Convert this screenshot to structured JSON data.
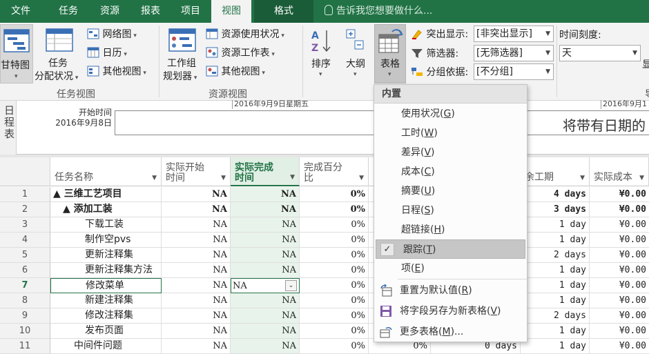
{
  "tabs": [
    {
      "label": "文件",
      "state": "normal"
    },
    {
      "label": "任务",
      "state": "normal"
    },
    {
      "label": "资源",
      "state": "normal"
    },
    {
      "label": "报表",
      "state": "normal"
    },
    {
      "label": "项目",
      "state": "normal"
    },
    {
      "label": "视图",
      "state": "active"
    },
    {
      "label": "格式",
      "state": "contextual"
    }
  ],
  "tell_me": "告诉我您想要做什么...",
  "ribbon": {
    "gantt_label": "甘特图",
    "task_usage_label_1": "任务",
    "task_usage_label_2": "分配状况",
    "network_label": "网络图",
    "calendar_label": "日历",
    "other_views_label": "其他视图",
    "task_views_group": "任务视图",
    "team_planner_label_1": "工作组",
    "team_planner_label_2": "规划器",
    "resource_usage_label": "资源使用状况",
    "resource_sheet_label": "资源工作表",
    "other_views_label_2": "其他视图",
    "resource_views_group": "资源视图",
    "sort_label": "排序",
    "outline_label": "大纲",
    "tables_label": "表格",
    "highlight_label": "突出显示:",
    "highlight_value": "[非突出显示]",
    "filter_label": "筛选器:",
    "filter_value": "[无筛选器]",
    "group_label": "分组依据:",
    "group_value": "[不分组]",
    "timescale_label": "时间刻度:",
    "timescale_value": "天",
    "display_label": "显",
    "partial_group_label": "导"
  },
  "timeline": {
    "side_label": "日程表",
    "start_label": "开始时间",
    "start_date": "2016年9月8日",
    "date_tick_1": "2016年9月9日星期五",
    "date_tick_2": "2016年9月1",
    "hint": "将带有日期的"
  },
  "grid": {
    "headers": {
      "task_name": "任务名称",
      "actual_start_1": "实际开始",
      "actual_start_2": "时间",
      "actual_finish_1": "实际完成",
      "actual_finish_2": "时间",
      "pct_complete_1": "完成百分",
      "pct_complete_2": "比",
      "remaining": "余工期",
      "actual_cost": "实际成本"
    },
    "rows": [
      {
        "id": "1",
        "name": "▲ 三维工艺项目",
        "start": "NA",
        "finish": "NA",
        "pct": "0%",
        "rem": "4 days",
        "cost": "¥0.00"
      },
      {
        "id": "2",
        "name": "▲ 添加工装",
        "start": "NA",
        "finish": "NA",
        "pct": "0%",
        "rem": "3 days",
        "cost": "¥0.00"
      },
      {
        "id": "3",
        "name": "下载工装",
        "start": "NA",
        "finish": "NA",
        "pct": "0%",
        "rem": "1 day",
        "cost": "¥0.00"
      },
      {
        "id": "4",
        "name": "制作空pvs",
        "start": "NA",
        "finish": "NA",
        "pct": "0%",
        "rem": "1 day",
        "cost": "¥0.00"
      },
      {
        "id": "5",
        "name": "更新注释集",
        "start": "NA",
        "finish": "NA",
        "pct": "0%",
        "rem": "2 days",
        "cost": "¥0.00"
      },
      {
        "id": "6",
        "name": "更新注释集方法",
        "start": "NA",
        "finish": "NA",
        "pct": "0%",
        "rem": "1 day",
        "cost": "¥0.00"
      },
      {
        "id": "7",
        "name": "修改菜单",
        "start": "NA",
        "finish": "NA",
        "pct": "0%",
        "rem": "1 day",
        "cost": "¥0.00"
      },
      {
        "id": "8",
        "name": "新建注释集",
        "start": "NA",
        "finish": "NA",
        "pct": "0%",
        "rem": "1 day",
        "cost": "¥0.00"
      },
      {
        "id": "9",
        "name": "修改注释集",
        "start": "NA",
        "finish": "NA",
        "pct": "0%",
        "rem": "2 days",
        "cost": "¥0.00"
      },
      {
        "id": "10",
        "name": "发布页面",
        "start": "NA",
        "finish": "NA",
        "pct": "0%",
        "rem": "1 day",
        "cost": "¥0.00"
      },
      {
        "id": "11",
        "name": "中间件问题",
        "start": "NA",
        "finish": "NA",
        "pct": "0%",
        "pct2": "0%",
        "dur": "0 days",
        "rem": "1 day",
        "cost": "¥0.00"
      }
    ]
  },
  "menu": {
    "header": "内置",
    "items": [
      {
        "label": "使用状况",
        "key": "G"
      },
      {
        "label": "工时",
        "key": "W"
      },
      {
        "label": "差异",
        "key": "V"
      },
      {
        "label": "成本",
        "key": "C"
      },
      {
        "label": "摘要",
        "key": "U"
      },
      {
        "label": "日程",
        "key": "S"
      },
      {
        "label": "超链接",
        "key": "H"
      },
      {
        "label": "跟踪",
        "key": "T"
      },
      {
        "label": "项",
        "key": "E"
      }
    ],
    "reset_label": "重置为默认值",
    "reset_key": "R",
    "save_label": "将字段另存为新表格",
    "save_key": "V",
    "more_label": "更多表格",
    "more_key": "M",
    "more_suffix": "..."
  },
  "colors": {
    "accent": "#217346",
    "selected_header": "#e1efe5"
  }
}
